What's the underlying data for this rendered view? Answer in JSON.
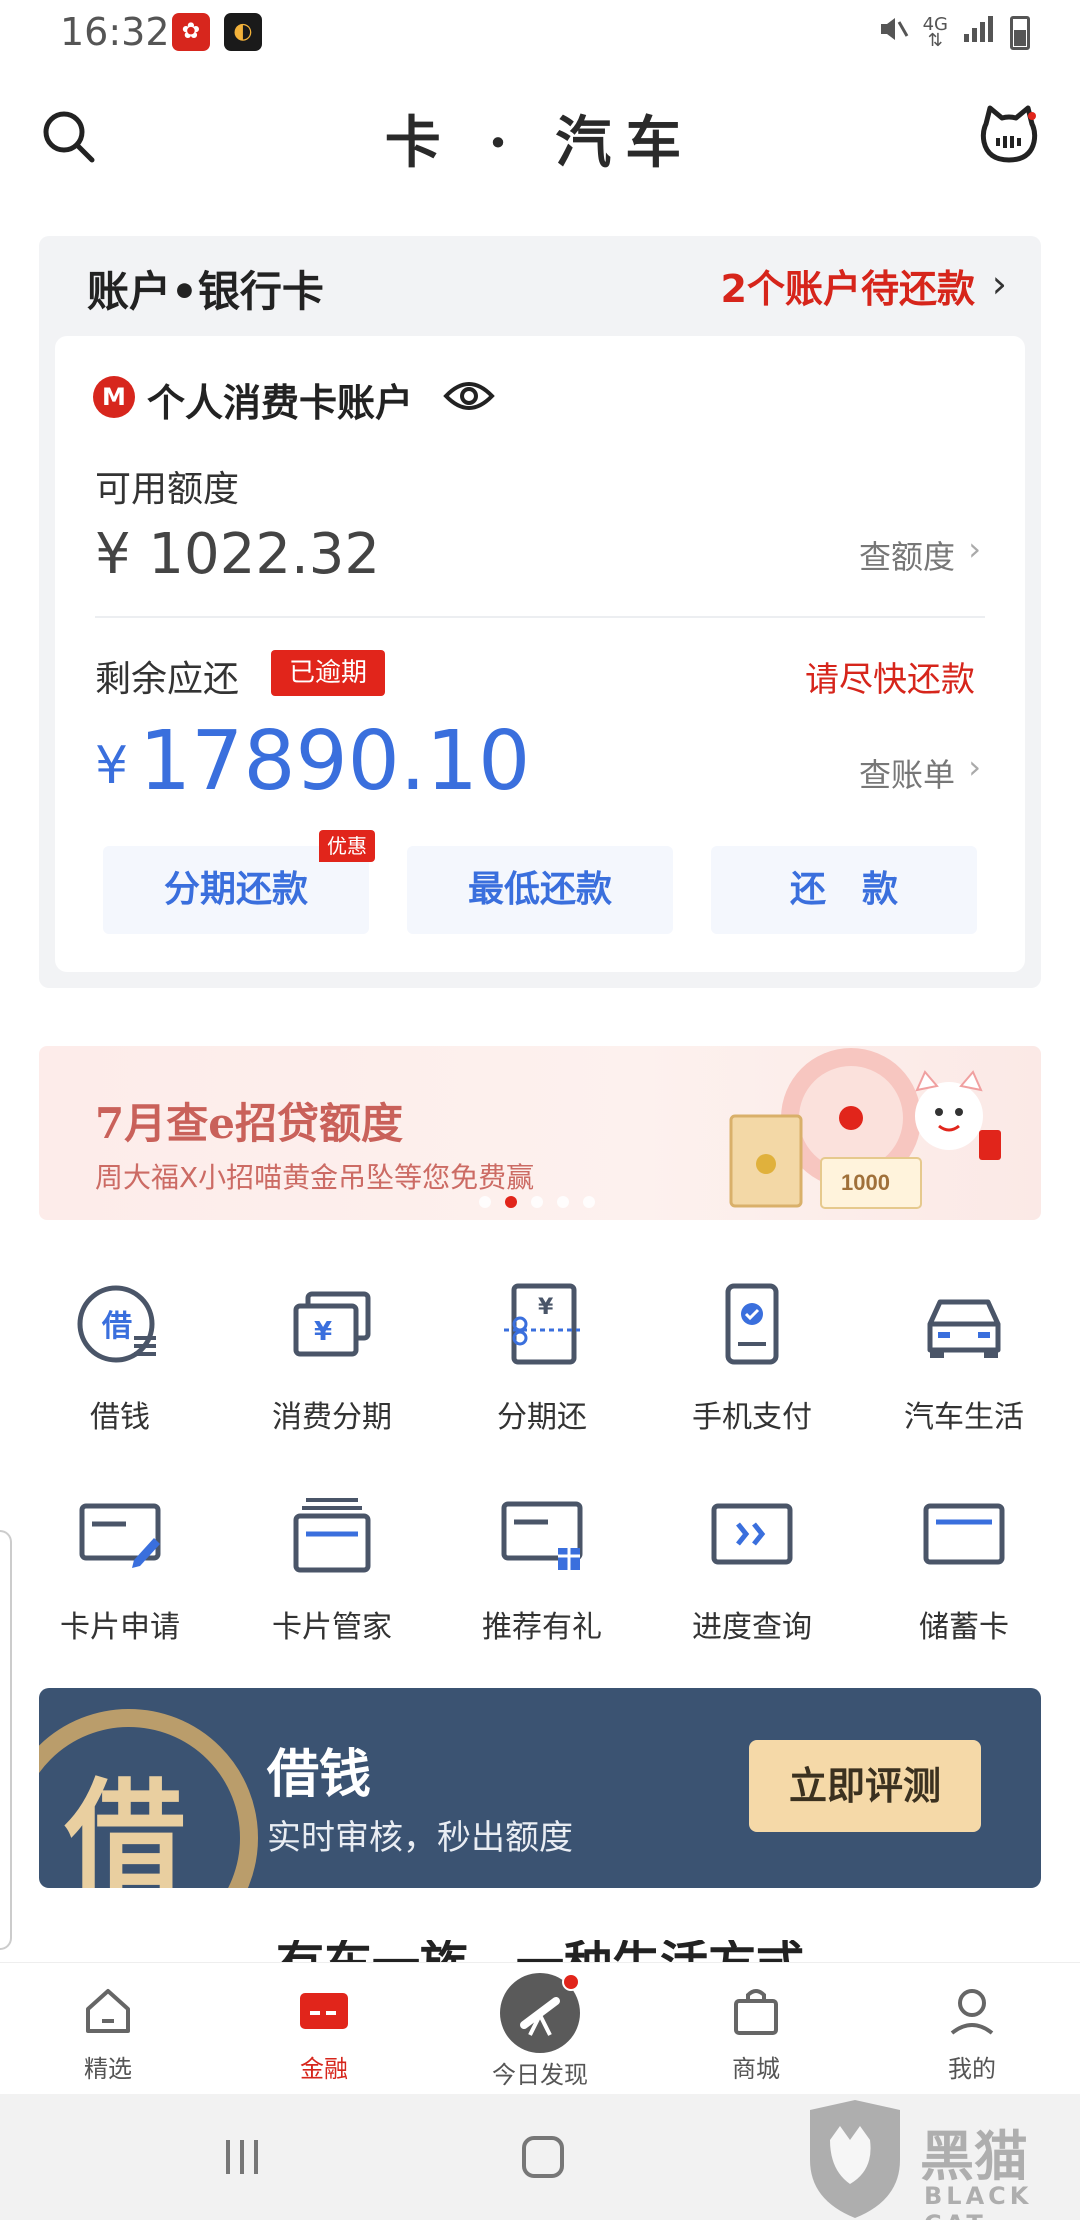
{
  "status_bar": {
    "time": "16:32",
    "network": "4G",
    "app_icons": [
      "bank-app-icon",
      "game-app-icon"
    ],
    "system_icons": [
      "mute-vibrate-icon",
      "signal-icon",
      "battery-icon"
    ]
  },
  "nav": {
    "title": "卡 · 汽车",
    "left_icon": "search-icon",
    "right_icon": "cat-assistant-icon"
  },
  "account": {
    "header_label": "账户•银行卡",
    "header_due": "2个账户待还款",
    "account_name": "个人消费卡账户",
    "bank_logo": "M",
    "available_label": "可用额度",
    "available_amount": "¥ 1022.32",
    "check_quota": "查额度",
    "remaining_label": "剩余应还",
    "overdue_badge": "已逾期",
    "urge_text": "请尽快还款",
    "remaining_currency": "¥",
    "remaining_amount": "17890.10",
    "check_bill": "查账单",
    "actions": [
      {
        "label": "分期还款",
        "tag": "优惠"
      },
      {
        "label": "最低还款"
      },
      {
        "label": "还　款"
      }
    ]
  },
  "banner": {
    "title": "7月查e招贷额度",
    "subtitle": "周大福X小招喵黄金吊坠等您免费赢",
    "coupon_text": "1000",
    "dots_total": 5,
    "dots_active_index": 1
  },
  "services": [
    {
      "label": "借钱",
      "icon": "loan-icon"
    },
    {
      "label": "消费分期",
      "icon": "installment-card-icon"
    },
    {
      "label": "分期还",
      "icon": "split-repay-icon"
    },
    {
      "label": "手机支付",
      "icon": "phone-pay-icon"
    },
    {
      "label": "汽车生活",
      "icon": "car-icon"
    },
    {
      "label": "卡片申请",
      "icon": "card-apply-icon"
    },
    {
      "label": "卡片管家",
      "icon": "card-manager-icon"
    },
    {
      "label": "推荐有礼",
      "icon": "referral-gift-icon"
    },
    {
      "label": "进度查询",
      "icon": "progress-query-icon"
    },
    {
      "label": "储蓄卡",
      "icon": "debit-card-icon"
    }
  ],
  "loan_banner": {
    "seal_char": "借",
    "title": "借钱",
    "subtitle": "实时审核，秒出额度",
    "button": "立即评测"
  },
  "peek_text": "有车一族，一种生活方式",
  "tabbar": [
    {
      "label": "精选",
      "icon": "home-icon"
    },
    {
      "label": "金融",
      "icon": "finance-card-icon",
      "active": true
    },
    {
      "label": "今日发现",
      "icon": "telescope-icon"
    },
    {
      "label": "商城",
      "icon": "shopping-bag-icon"
    },
    {
      "label": "我的",
      "icon": "profile-icon"
    }
  ],
  "watermark": {
    "text": "黑猫",
    "sub": "BLACK CAT"
  },
  "colors": {
    "accent_red": "#d6251b",
    "accent_blue": "#3a6fdd",
    "loan_banner_bg": "#3b5372",
    "loan_button_bg": "#f5d9a8"
  }
}
